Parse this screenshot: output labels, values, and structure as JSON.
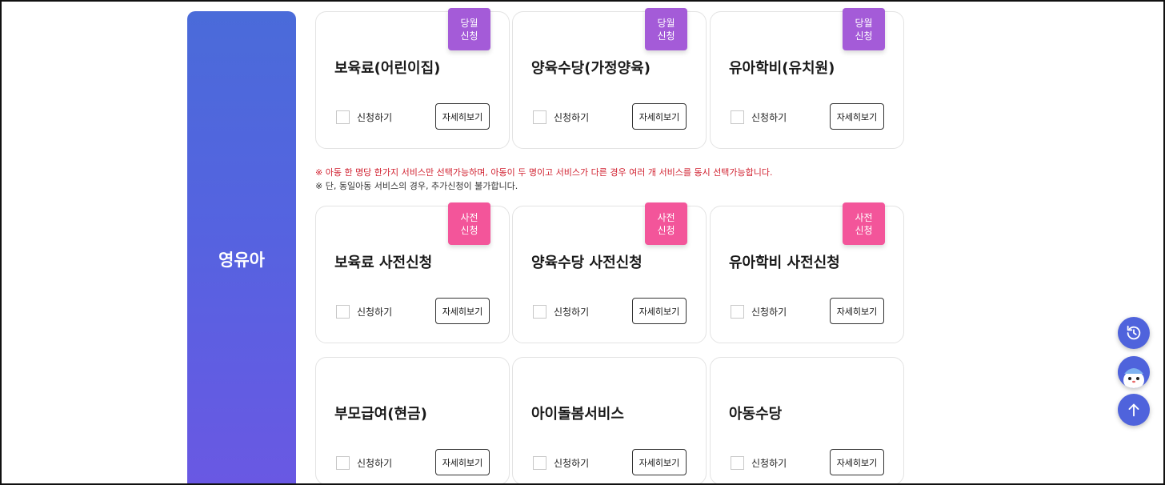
{
  "sidebar": {
    "category": "영유아"
  },
  "common": {
    "apply_label": "신청하기",
    "detail_label": "자세히보기"
  },
  "badges": {
    "month": [
      "당월",
      "신청"
    ],
    "pre": [
      "사전",
      "신청"
    ]
  },
  "cards": [
    {
      "title": "보육료(어린이집)",
      "badge": "month"
    },
    {
      "title": "양육수당(가정양육)",
      "badge": "month"
    },
    {
      "title": "유아학비(유치원)",
      "badge": "month"
    },
    {
      "title": "보육료 사전신청",
      "badge": "pre"
    },
    {
      "title": "양육수당 사전신청",
      "badge": "pre"
    },
    {
      "title": "유아학비 사전신청",
      "badge": "pre"
    },
    {
      "title": "부모급여(현금)",
      "badge": null
    },
    {
      "title": "아이돌봄서비스",
      "badge": null
    },
    {
      "title": "아동수당",
      "badge": null
    }
  ],
  "notices": {
    "line1": "※ 아동 한 명당 한가지 서비스만 선택가능하며, 아동이 두 명이고 서비스가 다른 경우 여러 개 서비스를 동시 선택가능합니다.",
    "line2": "※ 단, 동일아동 서비스의 경우, 추가신청이 불가합니다."
  },
  "fabs": [
    {
      "icon": "history-icon"
    },
    {
      "icon": "chatbot-avatar-icon"
    },
    {
      "icon": "arrow-up-icon"
    }
  ],
  "colors": {
    "sidebar": "#5563e0",
    "badge_month": "#a45bd8",
    "badge_pre": "#f3559a",
    "notice_red": "#d1202f",
    "fab": "#4f63dc"
  }
}
